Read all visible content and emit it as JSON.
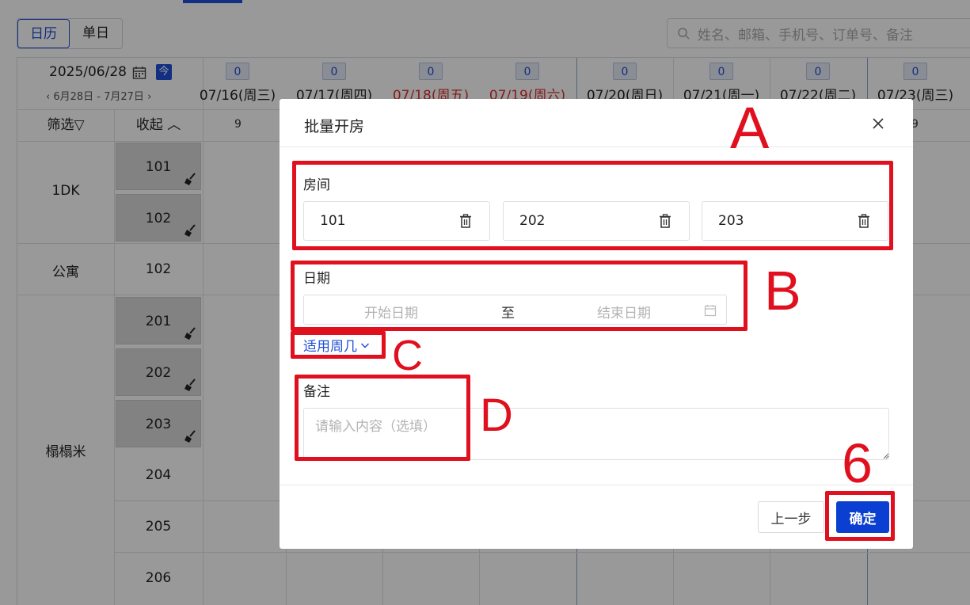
{
  "toolbar": {
    "view_calendar": "日历",
    "view_single": "单日",
    "search_placeholder": "姓名、邮箱、手机号、订单号、备注"
  },
  "calendar": {
    "current_date": "2025/06/28",
    "today_label": "今",
    "range": "6月28日 - 7月27日",
    "filter_label": "筛选",
    "collapse_label": "收起",
    "days": [
      {
        "count": "0",
        "label": "07/16(周三)",
        "small": "9",
        "weekend": false
      },
      {
        "count": "0",
        "label": "07/17(周四)",
        "small": "",
        "weekend": false
      },
      {
        "count": "0",
        "label": "07/18(周五)",
        "small": "",
        "weekend": true
      },
      {
        "count": "0",
        "label": "07/19(周六)",
        "small": "",
        "weekend": true
      },
      {
        "count": "0",
        "label": "07/20(周日)",
        "small": "",
        "weekend": false
      },
      {
        "count": "0",
        "label": "07/21(周一)",
        "small": "",
        "weekend": false
      },
      {
        "count": "0",
        "label": "07/22(周二)",
        "small": "",
        "weekend": false
      },
      {
        "count": "0",
        "label": "07/23(周三)",
        "small": "9",
        "weekend": false
      }
    ],
    "room_types": [
      {
        "name": "1DK"
      },
      {
        "name": "公寓"
      },
      {
        "name": "榻榻米"
      }
    ],
    "rooms": [
      "101",
      "102",
      "102",
      "201",
      "202",
      "203",
      "204",
      "205",
      "206"
    ]
  },
  "dialog": {
    "title": "批量开房",
    "room_label": "房间",
    "rooms": [
      "101",
      "202",
      "203"
    ],
    "date_label": "日期",
    "start_placeholder": "开始日期",
    "range_sep": "至",
    "end_placeholder": "结束日期",
    "weekday_link": "适用周几",
    "remark_label": "备注",
    "remark_placeholder": "请输入内容（选填）",
    "prev_button": "上一步",
    "ok_button": "确定"
  },
  "annotations": {
    "a": "A",
    "b": "B",
    "c": "C",
    "d": "D",
    "six": "6",
    "color": "#e0101e"
  }
}
